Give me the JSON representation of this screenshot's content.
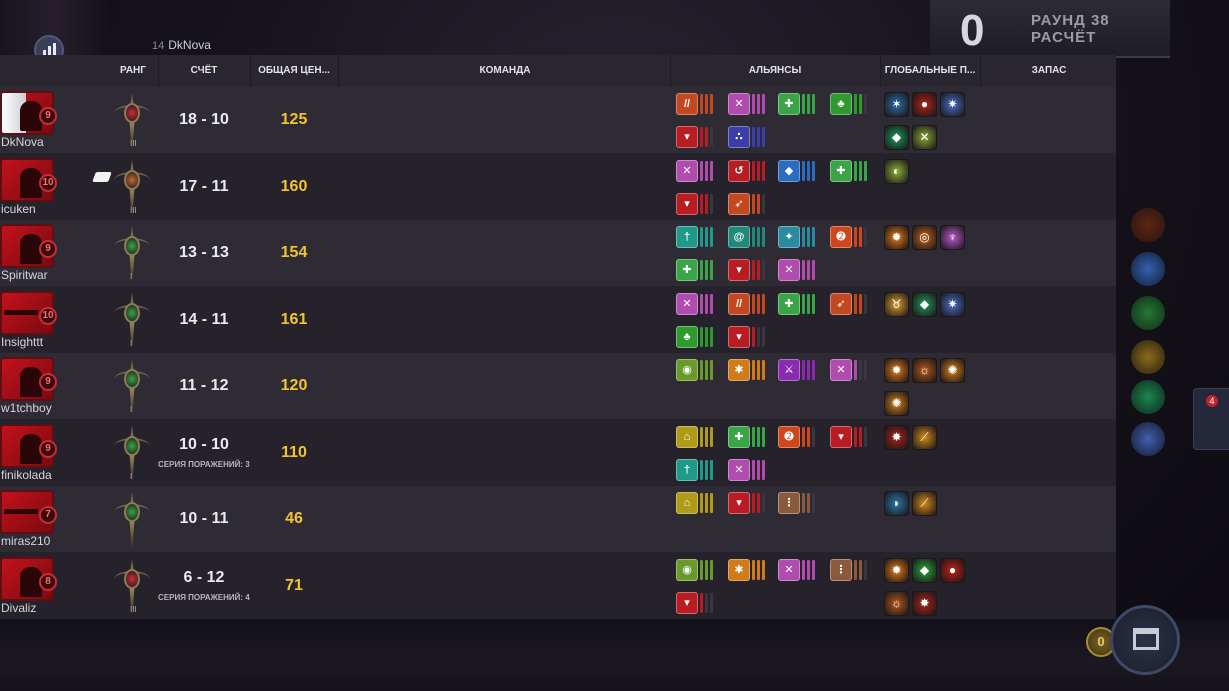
{
  "header": {
    "round_number": "0",
    "round_label": "РАУНД 38",
    "phase_label": "РАСЧЁТ",
    "current_player_level": "14",
    "current_player_name": "DkNova",
    "stats_icon": "bar-chart-icon"
  },
  "columns": {
    "rank": "РАНГ",
    "score": "СЧЁТ",
    "net_worth": "ОБЩАЯ ЦЕН...",
    "team": "КОМАНДА",
    "alliances": "АЛЬЯНСЫ",
    "global_items": "ГЛОБАЛЬНЫЕ П...",
    "bench": "ЗАПАС"
  },
  "colors": {
    "score_gold": "#f2c530",
    "avatar_red": "#c3121b"
  },
  "players": [
    {
      "name": "DkNova",
      "level": "9",
      "score": "18 - 10",
      "net_worth": "125",
      "streak": "",
      "rank_color": "#d02a36",
      "rank_pips": "III",
      "alliances": [
        {
          "icon": "claw-icon",
          "color": "#c3471f",
          "bars": 3
        },
        {
          "icon": "crossed-blades-icon",
          "color": "#b04cae",
          "bars": 3
        },
        {
          "icon": "shield-cross-icon",
          "color": "#3aa547",
          "bars": 3
        },
        {
          "icon": "leaf-icon",
          "color": "#2e9a2e",
          "bars": 2
        },
        {
          "icon": "demon-icon",
          "color": "#b81d24",
          "bars": 2
        },
        {
          "icon": "triad-icon",
          "color": "#3b3ea8",
          "bars": 3
        }
      ],
      "globals": [
        {
          "icon": "ice-shard-icon",
          "color": "#2d6ea8"
        },
        {
          "icon": "fire-ring-icon",
          "color": "#b0261a"
        },
        {
          "icon": "star-burst-icon",
          "color": "#4a6ec7"
        },
        {
          "icon": "emerald-icon",
          "color": "#1e9a5a"
        },
        {
          "icon": "tri-claw-icon",
          "color": "#8aa834"
        }
      ]
    },
    {
      "name": "icuken",
      "level": "10",
      "score": "17 - 11",
      "net_worth": "160",
      "streak": "",
      "rank_color": "#c8653a",
      "rank_pips": "III",
      "alliances": [
        {
          "icon": "crossed-blades-icon",
          "color": "#b04cae",
          "bars": 3
        },
        {
          "icon": "hook-icon",
          "color": "#b81d24",
          "bars": 3
        },
        {
          "icon": "shield-icon",
          "color": "#2a6cc0",
          "bars": 3
        },
        {
          "icon": "shield-cross-icon",
          "color": "#3aa547",
          "bars": 3
        },
        {
          "icon": "demon-icon",
          "color": "#b81d24",
          "bars": 2
        },
        {
          "icon": "bow-icon",
          "color": "#c3471f",
          "bars": 2
        }
      ],
      "globals": [
        {
          "icon": "potion-icon",
          "color": "#8bb03a"
        }
      ]
    },
    {
      "name": "Spiritwar",
      "level": "9",
      "score": "13 - 13",
      "net_worth": "154",
      "streak": "",
      "rank_color": "#3aa547",
      "rank_pips": "I",
      "alliances": [
        {
          "icon": "totem-icon",
          "color": "#1f9a8a",
          "bars": 3
        },
        {
          "icon": "swirl-icon",
          "color": "#1f8a7a",
          "bars": 3
        },
        {
          "icon": "sparkle-icon",
          "color": "#2a8aa0",
          "bars": 3
        },
        {
          "icon": "spiral-icon",
          "color": "#d0461c",
          "bars": 2
        },
        {
          "icon": "shield-cross-icon",
          "color": "#3aa547",
          "bars": 3
        },
        {
          "icon": "demon-icon",
          "color": "#b81d24",
          "bars": 2
        },
        {
          "icon": "crossed-blades-icon",
          "color": "#b04cae",
          "bars": 3
        }
      ],
      "globals": [
        {
          "icon": "explosion-icon",
          "color": "#e07a18"
        },
        {
          "icon": "cyclone-icon",
          "color": "#c0641a"
        },
        {
          "icon": "spirit-icon",
          "color": "#b45ac8"
        }
      ]
    },
    {
      "name": "Insighttt",
      "level": "10",
      "score": "14 - 11",
      "net_worth": "161",
      "streak": "",
      "rank_color": "#3aa547",
      "rank_pips": "I",
      "alliances": [
        {
          "icon": "crossed-blades-icon",
          "color": "#b04cae",
          "bars": 3
        },
        {
          "icon": "claw-icon",
          "color": "#c3471f",
          "bars": 3
        },
        {
          "icon": "shield-cross-icon",
          "color": "#3aa547",
          "bars": 3
        },
        {
          "icon": "bow-icon",
          "color": "#c3471f",
          "bars": 2
        },
        {
          "icon": "leaf-icon",
          "color": "#2e9a2e",
          "bars": 3
        },
        {
          "icon": "demon-icon",
          "color": "#b81d24",
          "bars": 1
        }
      ],
      "globals": [
        {
          "icon": "horned-skull-icon",
          "color": "#d8a030"
        },
        {
          "icon": "emerald-icon",
          "color": "#1e9a5a"
        },
        {
          "icon": "star-burst-icon",
          "color": "#4a6ec7"
        }
      ]
    },
    {
      "name": "w1tchboy",
      "level": "9",
      "score": "11 - 12",
      "net_worth": "120",
      "streak": "",
      "rank_color": "#3aa547",
      "rank_pips": "I",
      "alliances": [
        {
          "icon": "beast-icon",
          "color": "#6a9a2a",
          "bars": 3
        },
        {
          "icon": "gear-icon",
          "color": "#d07a1a",
          "bars": 3
        },
        {
          "icon": "dagger-icon",
          "color": "#8a2ab0",
          "bars": 3
        },
        {
          "icon": "crossed-blades-icon",
          "color": "#b04cae",
          "bars": 1
        }
      ],
      "globals": [
        {
          "icon": "explosion-icon",
          "color": "#e07a18"
        },
        {
          "icon": "sun-ring-icon",
          "color": "#b05a1a"
        },
        {
          "icon": "gear-burst-icon",
          "color": "#d0801a"
        },
        {
          "icon": "gear-burst-icon",
          "color": "#d0801a"
        }
      ]
    },
    {
      "name": "finikolada",
      "level": "9",
      "score": "10 - 10",
      "net_worth": "110",
      "streak": "СЕРИЯ ПОРАЖЕНИЙ: 3",
      "rank_color": "#3aa547",
      "rank_pips": "I",
      "alliances": [
        {
          "icon": "helm-icon",
          "color": "#b09a18",
          "bars": 3
        },
        {
          "icon": "shield-cross-icon",
          "color": "#3aa547",
          "bars": 3
        },
        {
          "icon": "spiral-icon",
          "color": "#d0461c",
          "bars": 2
        },
        {
          "icon": "demon-icon",
          "color": "#b81d24",
          "bars": 2
        },
        {
          "icon": "totem-icon",
          "color": "#1f9a8a",
          "bars": 3
        },
        {
          "icon": "crossed-blades-icon",
          "color": "#b04cae",
          "bars": 3
        }
      ],
      "globals": [
        {
          "icon": "beast-rage-icon",
          "color": "#a82618"
        },
        {
          "icon": "slash-icon",
          "color": "#d08a1a"
        }
      ]
    },
    {
      "name": "miras210",
      "level": "7",
      "score": "10 - 11",
      "net_worth": "46",
      "streak": "",
      "rank_color": "#3aa547",
      "rank_pips": "",
      "alliances": [
        {
          "icon": "helm-icon",
          "color": "#b09a18",
          "bars": 3
        },
        {
          "icon": "demon-icon",
          "color": "#b81d24",
          "bars": 2
        },
        {
          "icon": "footprint-icon",
          "color": "#8a5a3a",
          "bars": 2
        }
      ],
      "globals": [
        {
          "icon": "water-drop-icon",
          "color": "#2a7aa8"
        },
        {
          "icon": "slash-icon",
          "color": "#d08a1a"
        }
      ]
    },
    {
      "name": "Divaliz",
      "level": "8",
      "score": "6 - 12",
      "net_worth": "71",
      "streak": "СЕРИЯ ПОРАЖЕНИЙ: 4",
      "rank_color": "#d02a36",
      "rank_pips": "III",
      "alliances": [
        {
          "icon": "beast-icon",
          "color": "#6a9a2a",
          "bars": 3
        },
        {
          "icon": "gear-icon",
          "color": "#d07a1a",
          "bars": 3
        },
        {
          "icon": "crossed-blades-icon",
          "color": "#b04cae",
          "bars": 3
        },
        {
          "icon": "footprint-icon",
          "color": "#8a5a3a",
          "bars": 2
        },
        {
          "icon": "demon-icon",
          "color": "#b81d24",
          "bars": 1
        }
      ],
      "globals": [
        {
          "icon": "explosion-icon",
          "color": "#e07a18"
        },
        {
          "icon": "emerald-icon",
          "color": "#2aa83a"
        },
        {
          "icon": "fire-ring-icon",
          "color": "#c0241a"
        },
        {
          "icon": "sun-ring-icon",
          "color": "#b05a1a"
        },
        {
          "icon": "beast-rage-icon",
          "color": "#a82618"
        }
      ]
    }
  ],
  "side": {
    "bench_count": "4",
    "gold": "0",
    "shop_icon": "shop-icon"
  }
}
